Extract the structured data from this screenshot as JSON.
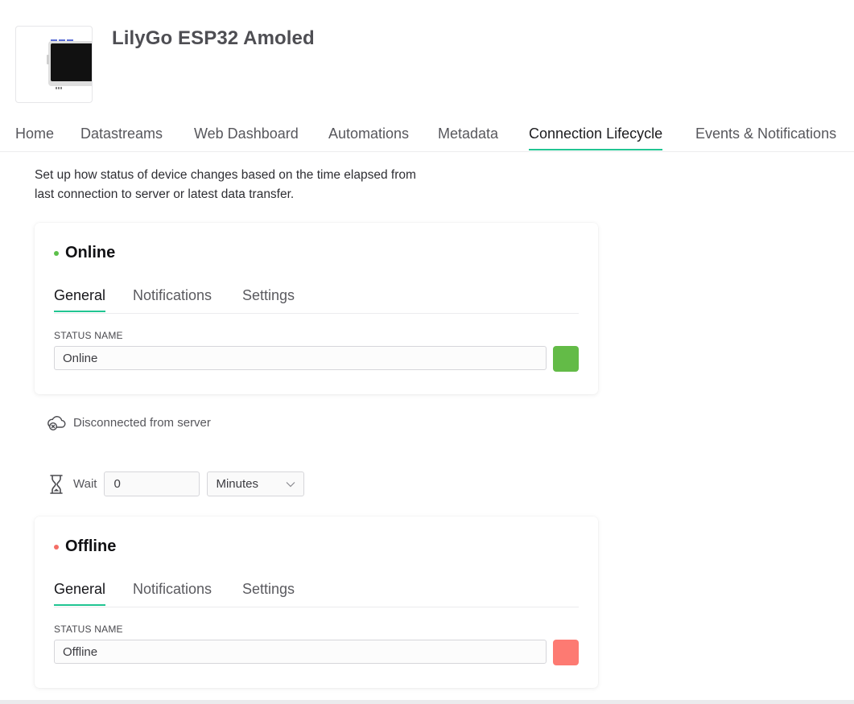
{
  "device": {
    "name": "LilyGo ESP32 Amoled"
  },
  "tabs": [
    {
      "label": "Home"
    },
    {
      "label": "Datastreams"
    },
    {
      "label": "Web Dashboard"
    },
    {
      "label": "Automations"
    },
    {
      "label": "Metadata"
    },
    {
      "label": "Connection Lifecycle",
      "active": true
    },
    {
      "label": "Events & Notifications"
    }
  ],
  "description": {
    "line1": "Set up how status of device changes based on the time elapsed from",
    "line2": "last connection to server or latest data transfer."
  },
  "online_card": {
    "title": "Online",
    "dot_color": "#5cc04a",
    "tabs": [
      "General",
      "Notifications",
      "Settings"
    ],
    "field_label": "STATUS NAME",
    "field_value": "Online",
    "color": "#63bb47"
  },
  "transition": {
    "text": "Disconnected from server"
  },
  "wait": {
    "label": "Wait",
    "value": "0",
    "unit": "Minutes"
  },
  "offline_card": {
    "title": "Offline",
    "dot_color": "#f46e66",
    "tabs": [
      "General",
      "Notifications",
      "Settings"
    ],
    "field_label": "STATUS NAME",
    "field_value": "Offline",
    "color": "#fd7a72"
  },
  "icons": {
    "transition": "cloud-disconnect-icon",
    "wait": "hourglass-icon",
    "select": "chevron-down-icon"
  },
  "accent_color": "#21c592"
}
